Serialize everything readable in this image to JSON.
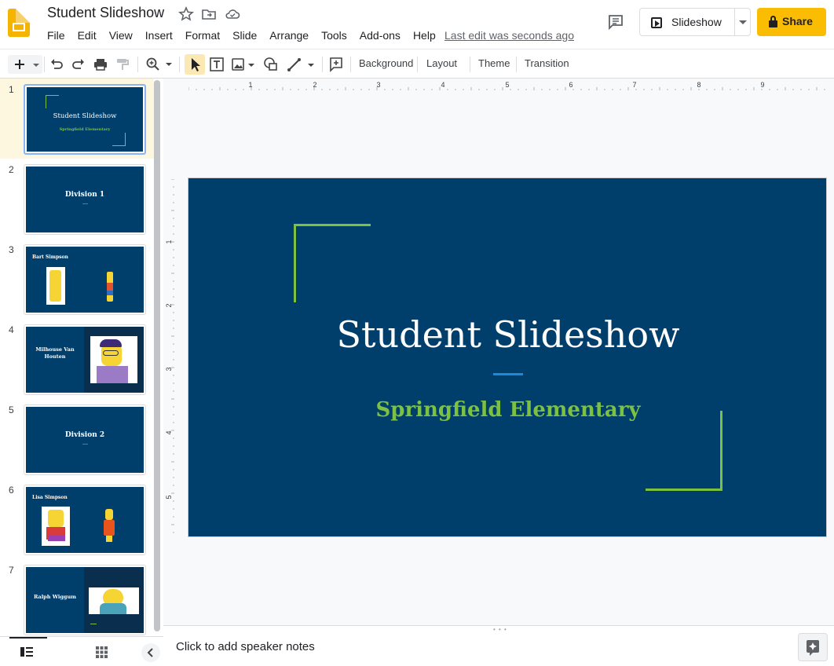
{
  "app": {
    "title": "Student Slideshow",
    "menus": [
      "File",
      "Edit",
      "View",
      "Insert",
      "Format",
      "Slide",
      "Arrange",
      "Tools",
      "Add-ons",
      "Help"
    ],
    "last_edit": "Last edit was seconds ago",
    "slideshow_label": "Slideshow",
    "share_label": "Share",
    "accent_color": "#fbbc04",
    "brand_color": "#f4b400"
  },
  "toolbar": {
    "background_label": "Background",
    "layout_label": "Layout",
    "theme_label": "Theme",
    "transition_label": "Transition"
  },
  "ruler": {
    "h_labels": [
      "1",
      "2",
      "3",
      "4",
      "5",
      "6",
      "7",
      "8",
      "9"
    ],
    "v_labels": [
      "1",
      "2",
      "3",
      "4",
      "5"
    ]
  },
  "filmstrip": {
    "active_index": 1,
    "slides": [
      {
        "number": "1",
        "title": "Student Slideshow",
        "subtitle": "Springfield Elementary"
      },
      {
        "number": "2",
        "title": "Division 1"
      },
      {
        "number": "3",
        "title": "Bart Simpson"
      },
      {
        "number": "4",
        "title": "Milhouse Van Houten"
      },
      {
        "number": "5",
        "title": "Division 2"
      },
      {
        "number": "6",
        "title": "Lisa Simpson"
      },
      {
        "number": "7",
        "title": "Ralph Wiggum"
      }
    ]
  },
  "slide": {
    "title": "Student Slideshow",
    "subtitle": "Springfield Elementary",
    "background_color": "#003e6b",
    "accent_color": "#7cc142",
    "divider_color": "#1e88d9"
  },
  "notes": {
    "placeholder": "Click to add speaker notes"
  }
}
